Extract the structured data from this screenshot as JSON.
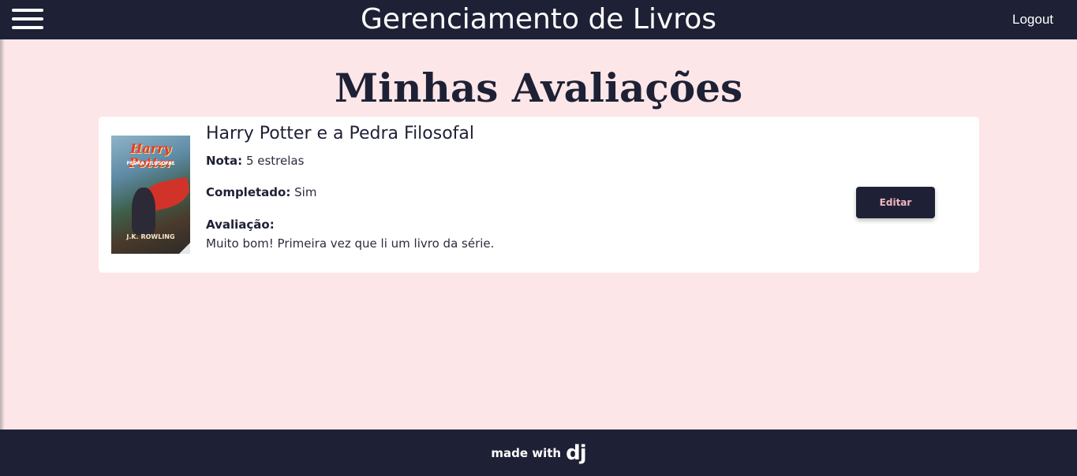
{
  "header": {
    "app_title": "Gerenciamento de Livros",
    "logout_label": "Logout",
    "menu_icon": "hamburger-menu-icon"
  },
  "page": {
    "heading": "Minhas Avaliações"
  },
  "reviews": [
    {
      "book_title": "Harry Potter e a Pedra Filosofal",
      "cover": {
        "title": "Harry Potter",
        "subtitle": "PEDRA FILOSOFAL",
        "author": "J.K. ROWLING"
      },
      "rating_label": "Nota:",
      "rating_value": "5 estrelas",
      "completed_label": "Completado:",
      "completed_value": "Sim",
      "review_label": "Avaliação:",
      "review_text": "Muito bom! Primeira vez que li um livro da série.",
      "edit_label": "Editar"
    }
  ],
  "footer": {
    "made_with": "made with",
    "logo_text": "dj"
  },
  "colors": {
    "navy": "#1e2135",
    "page_background": "#fce6e8",
    "card_background": "#ffffff",
    "button_text": "#f2b6c0"
  }
}
